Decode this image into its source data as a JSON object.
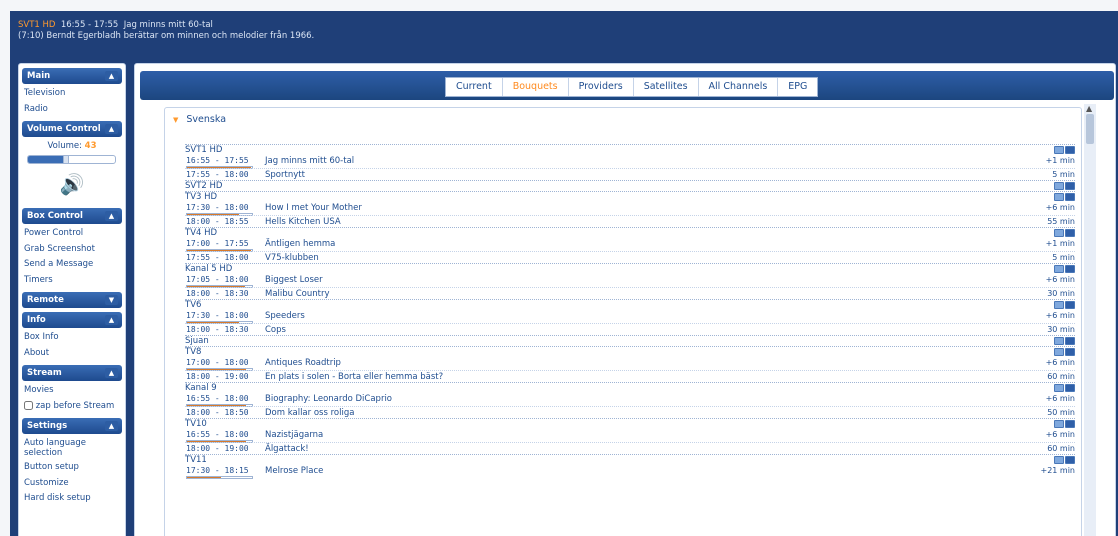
{
  "topbar": {
    "channel": "SVT1 HD",
    "time": "16:55 - 17:55",
    "title": "Jag minns mitt 60-tal",
    "desc": "(7:10) Berndt Egerbladh berättar om minnen och melodier från 1966."
  },
  "sidebar": {
    "main": {
      "header": "Main",
      "items": [
        "Television",
        "Radio"
      ]
    },
    "volume": {
      "header": "Volume Control",
      "label": "Volume:",
      "value": "43",
      "level": 0.43
    },
    "box": {
      "header": "Box Control",
      "items": [
        "Power Control",
        "Grab Screenshot",
        "Send a Message",
        "Timers"
      ]
    },
    "remote": {
      "header": "Remote"
    },
    "info": {
      "header": "Info",
      "items": [
        "Box Info",
        "About"
      ]
    },
    "stream": {
      "header": "Stream",
      "items": [
        "Movies"
      ],
      "checkbox": "zap before Stream"
    },
    "settings": {
      "header": "Settings",
      "items": [
        "Auto language selection",
        "Button setup",
        "Customize",
        "Hard disk setup"
      ]
    }
  },
  "tabs": [
    "Current",
    "Bouquets",
    "Providers",
    "Satellites",
    "All Channels",
    "EPG"
  ],
  "active_tab": "Bouquets",
  "bouquet": "Svenska",
  "channels": [
    {
      "name": "SVT1 HD",
      "events": [
        {
          "time": "16:55 - 17:55",
          "title": "Jag minns mitt 60-tal",
          "dur": "+1 min",
          "progress": 0.98
        },
        {
          "time": "17:55 - 18:00",
          "title": "Sportnytt",
          "dur": "5 min"
        }
      ]
    },
    {
      "name": "SVT2 HD",
      "events": []
    },
    {
      "name": "TV3 HD",
      "events": [
        {
          "time": "17:30 - 18:00",
          "title": "How I met Your Mother",
          "dur": "+6 min",
          "progress": 0.8
        },
        {
          "time": "18:00 - 18:55",
          "title": "Hells Kitchen USA",
          "dur": "55 min"
        }
      ]
    },
    {
      "name": "TV4 HD",
      "events": [
        {
          "time": "17:00 - 17:55",
          "title": "Äntligen hemma",
          "dur": "+1 min",
          "progress": 0.98
        },
        {
          "time": "17:55 - 18:00",
          "title": "V75-klubben",
          "dur": "5 min"
        }
      ]
    },
    {
      "name": "Kanal 5 HD",
      "events": [
        {
          "time": "17:05 - 18:00",
          "title": "Biggest Loser",
          "dur": "+6 min",
          "progress": 0.89
        },
        {
          "time": "18:00 - 18:30",
          "title": "Malibu Country",
          "dur": "30 min"
        }
      ]
    },
    {
      "name": "TV6",
      "events": [
        {
          "time": "17:30 - 18:00",
          "title": "Speeders",
          "dur": "+6 min",
          "progress": 0.8
        },
        {
          "time": "18:00 - 18:30",
          "title": "Cops",
          "dur": "30 min"
        }
      ]
    },
    {
      "name": "Sjuan",
      "events": []
    },
    {
      "name": "TV8",
      "events": [
        {
          "time": "17:00 - 18:00",
          "title": "Antiques Roadtrip",
          "dur": "+6 min",
          "progress": 0.9
        },
        {
          "time": "18:00 - 19:00",
          "title": "En plats i solen - Borta eller hemma bäst?",
          "dur": "60 min"
        }
      ]
    },
    {
      "name": "Kanal 9",
      "events": [
        {
          "time": "16:55 - 18:00",
          "title": "Biography: Leonardo DiCaprio",
          "dur": "+6 min",
          "progress": 0.91
        },
        {
          "time": "18:00 - 18:50",
          "title": "Dom kallar oss roliga",
          "dur": "50 min"
        }
      ]
    },
    {
      "name": "TV10",
      "events": [
        {
          "time": "16:55 - 18:00",
          "title": "Nazistjägarna",
          "dur": "+6 min",
          "progress": 0.91
        },
        {
          "time": "18:00 - 19:00",
          "title": "Älgattack!",
          "dur": "60 min"
        }
      ]
    },
    {
      "name": "TV11",
      "events": [
        {
          "time": "17:30 - 18:15",
          "title": "Melrose Place",
          "dur": "+21 min",
          "progress": 0.53
        }
      ]
    }
  ]
}
